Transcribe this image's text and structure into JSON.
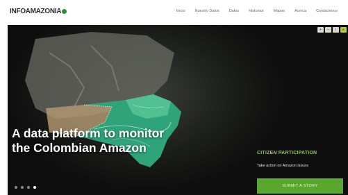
{
  "header": {
    "logo_text": "INFOAMAZONIA",
    "nav": [
      "Inicio",
      "Nuestro Datos",
      "Datos",
      "Historias",
      "Mapas",
      "Acerca",
      "Contáctenos"
    ]
  },
  "hero": {
    "title": "A data platform to monitor the Colombian Amazon",
    "slides": 4,
    "active_slide": 4,
    "tools": [
      "+",
      "−",
      "i",
      "◐"
    ],
    "citizen_participation": {
      "heading": "CITIZEN PARTICIPATION",
      "subtext": "Take action on Amazon issues",
      "button_label": "SUBMIT A STORY"
    }
  },
  "colors": {
    "accent_green": "#5aa72e",
    "heading_green": "#8dcf3a",
    "region_fill": "#2fa37a"
  }
}
